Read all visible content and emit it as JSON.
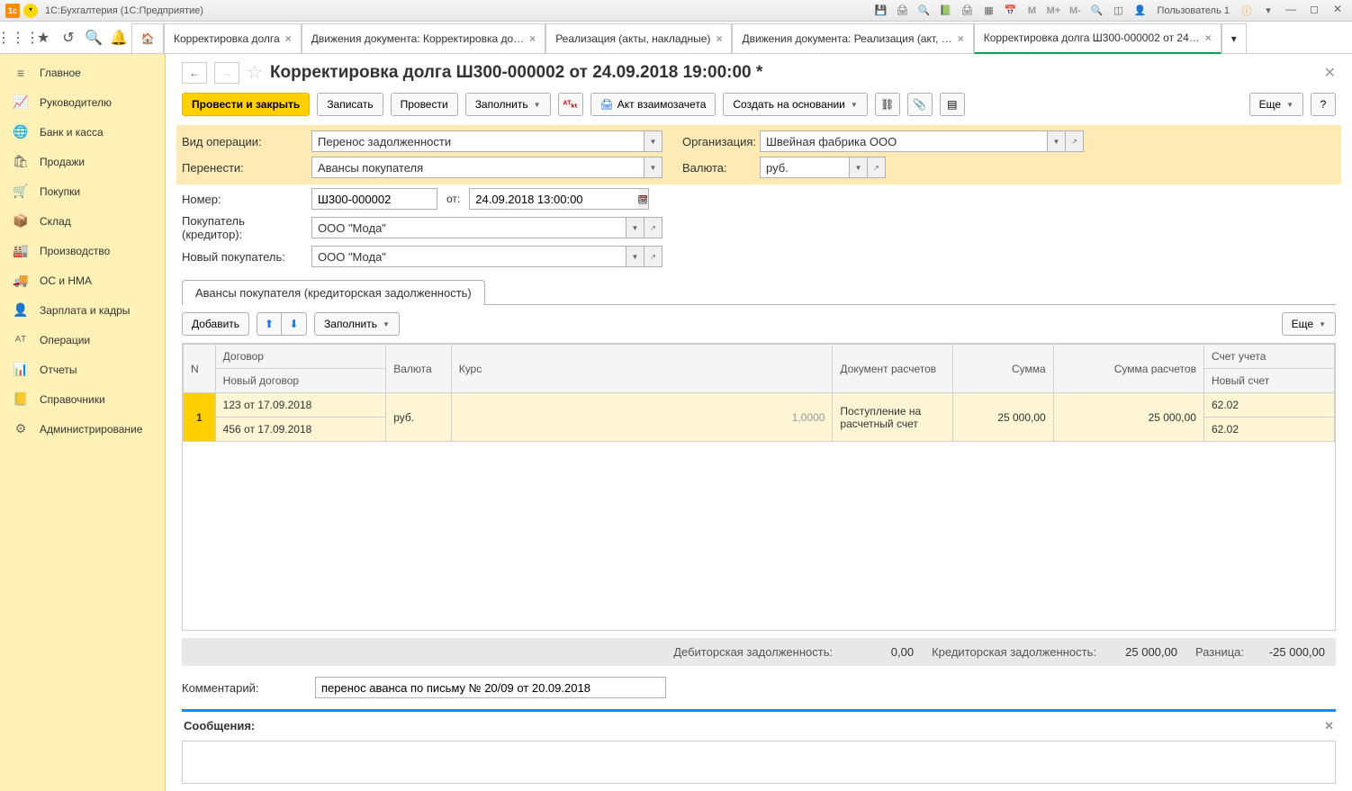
{
  "title_bar": {
    "app_title": "1С:Бухгалтерия  (1С:Предприятие)",
    "user_label": "Пользователь 1"
  },
  "top_tabs": [
    {
      "label": "Корректировка долга"
    },
    {
      "label": "Движения документа: Корректировка до…"
    },
    {
      "label": "Реализация (акты, накладные)"
    },
    {
      "label": "Движения документа: Реализация (акт, …"
    },
    {
      "label": "Корректировка долга Ш300-000002 от 24…",
      "active": true
    }
  ],
  "sidebar": {
    "items": [
      {
        "icon": "≡",
        "label": "Главное"
      },
      {
        "icon": "📈",
        "label": "Руководителю"
      },
      {
        "icon": "🌐",
        "label": "Банк и касса"
      },
      {
        "icon": "🛍",
        "label": "Продажи"
      },
      {
        "icon": "🛒",
        "label": "Покупки"
      },
      {
        "icon": "📦",
        "label": "Склад"
      },
      {
        "icon": "🏭",
        "label": "Производство"
      },
      {
        "icon": "🚚",
        "label": "ОС и НМА"
      },
      {
        "icon": "👤",
        "label": "Зарплата и кадры"
      },
      {
        "icon": "ᴬᵀ",
        "label": "Операции"
      },
      {
        "icon": "📊",
        "label": "Отчеты"
      },
      {
        "icon": "📒",
        "label": "Справочники"
      },
      {
        "icon": "⚙",
        "label": "Администрирование"
      }
    ]
  },
  "document": {
    "title": "Корректировка долга Ш300-000002 от 24.09.2018 19:00:00 *",
    "toolbar": {
      "post_close": "Провести и закрыть",
      "write": "Записать",
      "post": "Провести",
      "fill": "Заполнить",
      "act": "Акт взаимозачета",
      "create_based": "Создать на основании",
      "more": "Еще",
      "help": "?"
    },
    "fields": {
      "op_type_label": "Вид операции:",
      "op_type_value": "Перенос задолженности",
      "transfer_label": "Перенести:",
      "transfer_value": "Авансы покупателя",
      "number_label": "Номер:",
      "number_value": "Ш300-000002",
      "from_label": "от:",
      "date_value": "24.09.2018 13:00:00",
      "buyer_label": "Покупатель (кредитор):",
      "buyer_value": "ООО \"Мода\"",
      "new_buyer_label": "Новый покупатель:",
      "new_buyer_value": "ООО \"Мода\"",
      "org_label": "Организация:",
      "org_value": "Швейная фабрика ООО",
      "currency_label": "Валюта:",
      "currency_value": "руб."
    },
    "tab_label": "Авансы покупателя (кредиторская задолженность)",
    "table_toolbar": {
      "add": "Добавить",
      "fill": "Заполнить",
      "more": "Еще"
    },
    "table": {
      "headers": {
        "n": "N",
        "contract": "Договор",
        "new_contract": "Новый договор",
        "currency": "Валюта",
        "rate": "Курс",
        "doc": "Документ расчетов",
        "sum": "Сумма",
        "sum_calc": "Сумма расчетов",
        "account": "Счет учета",
        "new_account": "Новый счет"
      },
      "rows": [
        {
          "n": "1",
          "contract": "123 от 17.09.2018",
          "new_contract": "456 от 17.09.2018",
          "currency": "руб.",
          "rate": "1,0000",
          "doc": "Поступление на расчетный счет",
          "sum": "25 000,00",
          "sum_calc": "25 000,00",
          "account": "62.02",
          "new_account": "62.02"
        }
      ]
    },
    "totals": {
      "debit_label": "Дебиторская задолженность:",
      "debit_value": "0,00",
      "credit_label": "Кредиторская задолженность:",
      "credit_value": "25 000,00",
      "diff_label": "Разница:",
      "diff_value": "-25 000,00"
    },
    "comment_label": "Комментарий:",
    "comment_value": "перенос аванса по письму № 20/09 от 20.09.2018",
    "messages_label": "Сообщения:"
  }
}
